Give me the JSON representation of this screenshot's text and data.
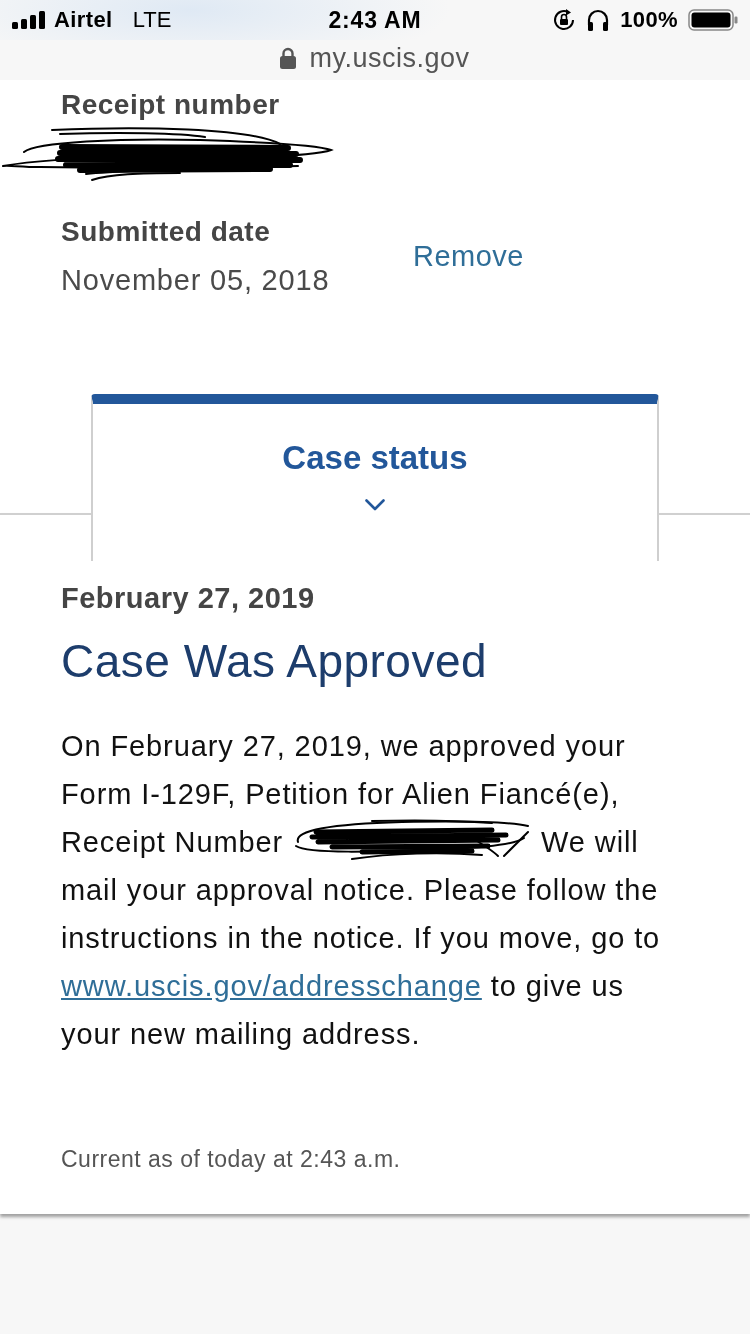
{
  "status_bar": {
    "carrier": "Airtel",
    "network": "LTE",
    "time": "2:43 AM",
    "battery": "100%"
  },
  "address_bar": {
    "url": "my.uscis.gov"
  },
  "case_summary": {
    "receipt": {
      "label": "Receipt number",
      "value": {
        "kind": "redacted"
      }
    },
    "submitted": {
      "label": "Submitted date",
      "value": "November 05, 2018"
    },
    "remove_link": "Remove"
  },
  "tabs": [
    {
      "label": "Case status",
      "selected": true
    }
  ],
  "status_card": {
    "date": "February 27, 2019",
    "title": "Case Was Approved",
    "body": [
      {
        "kind": "text",
        "text": "On February 27, 2019, we approved your Form I-129F, Petition for Alien Fiancé(e), Receipt Number"
      },
      {
        "kind": "redacted"
      },
      {
        "kind": "text",
        "text": "We will mail your approval notice. Please follow the instructions in the notice. If you move, go to"
      },
      {
        "kind": "link",
        "text": "www.uscis.gov/addresschange"
      },
      {
        "kind": "text",
        "text": "to give us your new mailing address."
      }
    ],
    "updated": "Current as of today at 2:43 a.m."
  }
}
